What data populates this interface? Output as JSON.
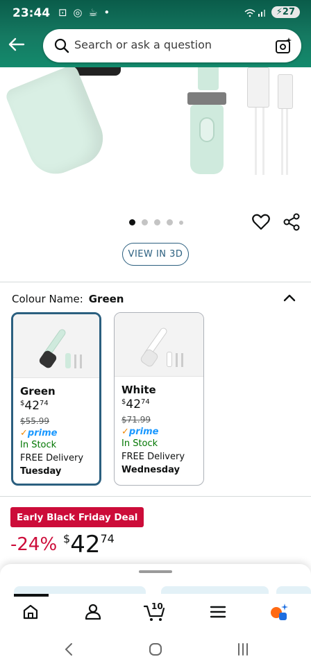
{
  "status_bar": {
    "time": "23:44",
    "left_icons": "⊡ ◎ ☕ •",
    "signal_icons": "wifi signal",
    "battery": "27"
  },
  "search": {
    "placeholder": "Search or ask a question"
  },
  "carousel": {
    "page_count": 5,
    "active_index": 0
  },
  "view_3d_label": "VIEW IN 3D",
  "colour": {
    "label": "Colour Name:",
    "selected": "Green"
  },
  "variants": [
    {
      "name": "Green",
      "price_symbol": "$",
      "price_whole": "42",
      "price_fraction": "74",
      "list_price": "$55.99",
      "prime": "prime",
      "stock": "In Stock",
      "delivery": "FREE Delivery",
      "day": "Tuesday",
      "selected": true,
      "color": "#cfeadd"
    },
    {
      "name": "White",
      "price_symbol": "$",
      "price_whole": "42",
      "price_fraction": "74",
      "list_price": "$71.99",
      "prime": "prime",
      "stock": "In Stock",
      "delivery": "FREE Delivery",
      "day": "Wednesday",
      "selected": false,
      "color": "#ffffff"
    }
  ],
  "deal": {
    "badge": "Early Black Friday Deal",
    "discount": "-24%",
    "price_symbol": "$",
    "price_whole": "42",
    "price_fraction": "74"
  },
  "bottom_nav": {
    "cart_count": "10",
    "items": [
      "home-icon",
      "account-icon",
      "cart-icon",
      "menu-icon",
      "rufus-icon"
    ]
  },
  "colors": {
    "header_green": "#157a62",
    "deal_red": "#cc0c39",
    "link_blue": "#2b5f7f",
    "stock_green": "#007600"
  }
}
